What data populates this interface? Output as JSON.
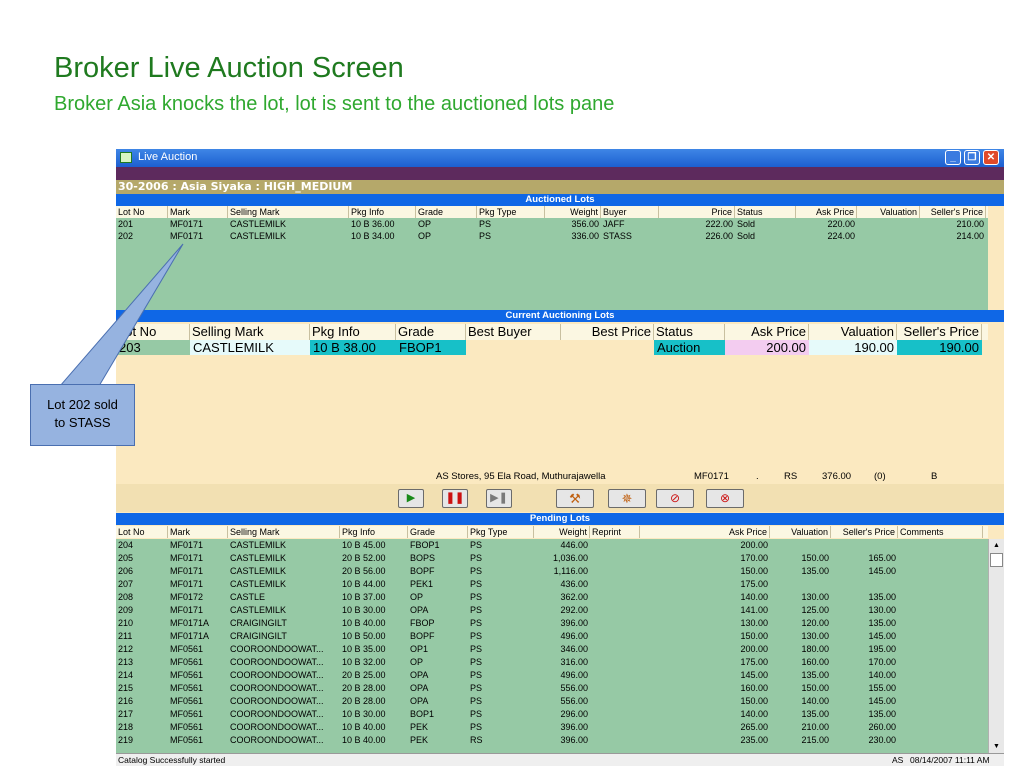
{
  "slide": {
    "title": "Broker Live Auction Screen",
    "subtitle": "Broker Asia knocks the lot, lot is sent to the auctioned lots pane"
  },
  "window": {
    "title": "Live Auction",
    "info": "30-2006 : Asia Siyaka  : HIGH_MEDIUM",
    "buttons": [
      "minimize",
      "restore",
      "close"
    ]
  },
  "auctioned": {
    "title": "Auctioned Lots",
    "headers": [
      "Lot No",
      "Mark",
      "Selling Mark",
      "Pkg Info",
      "Grade",
      "Pkg Type",
      "Weight",
      "Buyer",
      "Price",
      "Status",
      "Ask Price",
      "Valuation",
      "Seller's Price"
    ],
    "rows": [
      [
        "201",
        "MF0171",
        "CASTLEMILK",
        "10 B 36.00",
        "OP",
        "PS",
        "356.00",
        "JAFF",
        "222.00",
        "Sold",
        "220.00",
        "",
        "210.00"
      ],
      [
        "202",
        "MF0171",
        "CASTLEMILK",
        "10 B 34.00",
        "OP",
        "PS",
        "336.00",
        "STASS",
        "226.00",
        "Sold",
        "224.00",
        "",
        "214.00"
      ]
    ]
  },
  "current": {
    "title": "Current Auctioning Lots",
    "headers": [
      "Lot No",
      "Selling Mark",
      "Pkg Info",
      "Grade",
      "Best Buyer",
      "Best Price",
      "Status",
      "Ask Price",
      "Valuation",
      "Seller's Price"
    ],
    "row": [
      "203",
      "CASTLEMILK",
      "10 B 38.00",
      "FBOP1",
      "",
      "",
      "Auction",
      "200.00",
      "190.00",
      "190.00"
    ]
  },
  "address": {
    "store": "AS Stores, 95 Ela Road, Muthurajawella",
    "mark": "MF0171",
    "dot": ".",
    "currency": "RS",
    "amount": "376.00",
    "count": "(0)",
    "code": "B"
  },
  "toolbar": [
    "play-button",
    "pause-button",
    "next-button",
    "gavel-button",
    "withdraw-button",
    "cancel-lot-button",
    "cancel-all-button"
  ],
  "pending": {
    "title": "Pending Lots",
    "headers": [
      "Lot No",
      "Mark",
      "Selling Mark",
      "Pkg Info",
      "Grade",
      "Pkg Type",
      "Weight",
      "Reprint",
      "Ask Price",
      "Valuation",
      "Seller's Price",
      "Comments"
    ],
    "rows": [
      [
        "204",
        "MF0171",
        "CASTLEMILK",
        "10 B 45.00",
        "FBOP1",
        "PS",
        "446.00",
        "",
        "200.00",
        "",
        "",
        ""
      ],
      [
        "205",
        "MF0171",
        "CASTLEMILK",
        "20 B 52.00",
        "BOPS",
        "PS",
        "1,036.00",
        "",
        "170.00",
        "150.00",
        "165.00",
        ""
      ],
      [
        "206",
        "MF0171",
        "CASTLEMILK",
        "20 B 56.00",
        "BOPF",
        "PS",
        "1,116.00",
        "",
        "150.00",
        "135.00",
        "145.00",
        ""
      ],
      [
        "207",
        "MF0171",
        "CASTLEMILK",
        "10 B 44.00",
        "PEK1",
        "PS",
        "436.00",
        "",
        "175.00",
        "",
        "",
        ""
      ],
      [
        "208",
        "MF0172",
        "CASTLE",
        "10 B 37.00",
        "OP",
        "PS",
        "362.00",
        "",
        "140.00",
        "130.00",
        "135.00",
        ""
      ],
      [
        "209",
        "MF0171",
        "CASTLEMILK",
        "10 B 30.00",
        "OPA",
        "PS",
        "292.00",
        "",
        "141.00",
        "125.00",
        "130.00",
        ""
      ],
      [
        "210",
        "MF0171A",
        "CRAIGINGILT",
        "10 B 40.00",
        "FBOP",
        "PS",
        "396.00",
        "",
        "130.00",
        "120.00",
        "135.00",
        ""
      ],
      [
        "211",
        "MF0171A",
        "CRAIGINGILT",
        "10 B 50.00",
        "BOPF",
        "PS",
        "496.00",
        "",
        "150.00",
        "130.00",
        "145.00",
        ""
      ],
      [
        "212",
        "MF0561",
        "COOROONDOOWAT...",
        "10 B 35.00",
        "OP1",
        "PS",
        "346.00",
        "",
        "200.00",
        "180.00",
        "195.00",
        ""
      ],
      [
        "213",
        "MF0561",
        "COOROONDOOWAT...",
        "10 B 32.00",
        "OP",
        "PS",
        "316.00",
        "",
        "175.00",
        "160.00",
        "170.00",
        ""
      ],
      [
        "214",
        "MF0561",
        "COOROONDOOWAT...",
        "20 B 25.00",
        "OPA",
        "PS",
        "496.00",
        "",
        "145.00",
        "135.00",
        "140.00",
        ""
      ],
      [
        "215",
        "MF0561",
        "COOROONDOOWAT...",
        "20 B 28.00",
        "OPA",
        "PS",
        "556.00",
        "",
        "160.00",
        "150.00",
        "155.00",
        ""
      ],
      [
        "216",
        "MF0561",
        "COOROONDOOWAT...",
        "20 B 28.00",
        "OPA",
        "PS",
        "556.00",
        "",
        "150.00",
        "140.00",
        "145.00",
        ""
      ],
      [
        "217",
        "MF0561",
        "COOROONDOOWAT...",
        "10 B 30.00",
        "BOP1",
        "PS",
        "296.00",
        "",
        "140.00",
        "135.00",
        "135.00",
        ""
      ],
      [
        "218",
        "MF0561",
        "COOROONDOOWAT...",
        "10 B 40.00",
        "PEK",
        "PS",
        "396.00",
        "",
        "265.00",
        "210.00",
        "260.00",
        ""
      ],
      [
        "219",
        "MF0561",
        "COOROONDOOWAT...",
        "10 B 40.00",
        "PEK",
        "RS",
        "396.00",
        "",
        "235.00",
        "215.00",
        "230.00",
        ""
      ]
    ]
  },
  "status": {
    "message": "Catalog Successfully started",
    "user": "AS",
    "datetime": "08/14/2007 11:11 AM"
  },
  "callout": {
    "line1": "Lot 202 sold",
    "line2": "to STASS"
  }
}
